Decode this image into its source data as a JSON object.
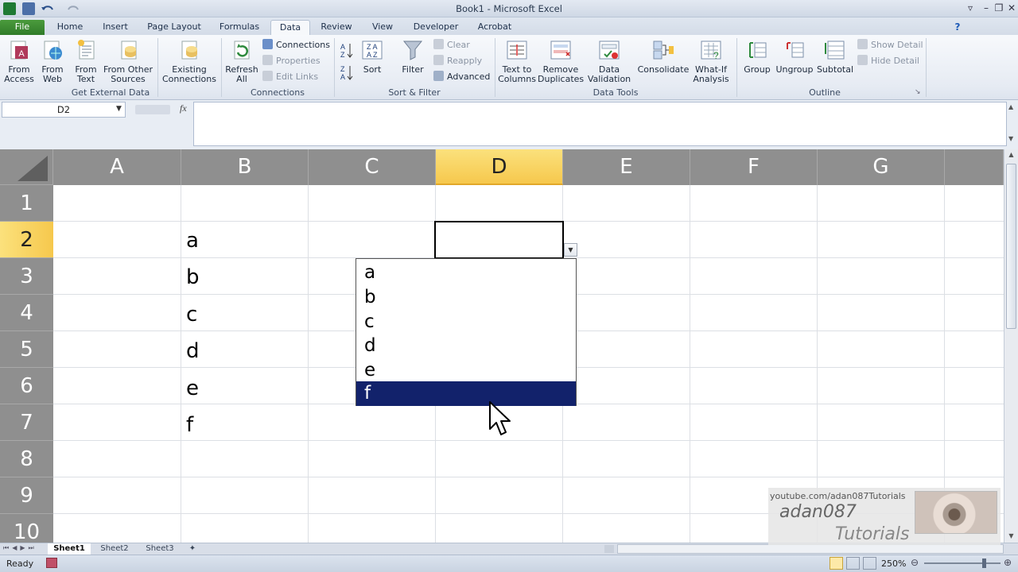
{
  "window": {
    "title": "Book1  -  Microsoft Excel"
  },
  "tabs": [
    {
      "label": "File"
    },
    {
      "label": "Home"
    },
    {
      "label": "Insert"
    },
    {
      "label": "Page Layout"
    },
    {
      "label": "Formulas"
    },
    {
      "label": "Data"
    },
    {
      "label": "Review"
    },
    {
      "label": "View"
    },
    {
      "label": "Developer"
    },
    {
      "label": "Acrobat"
    }
  ],
  "ribbon": {
    "external": {
      "label": "Get External Data",
      "from_access": [
        "From",
        "Access"
      ],
      "from_web": [
        "From",
        "Web"
      ],
      "from_text": [
        "From",
        "Text"
      ],
      "from_other": [
        "From Other",
        "Sources"
      ],
      "existing": [
        "Existing",
        "Connections"
      ]
    },
    "connections": {
      "label": "Connections",
      "refresh": [
        "Refresh",
        "All"
      ],
      "connections": "Connections",
      "properties": "Properties",
      "edit_links": "Edit Links"
    },
    "sortfilter": {
      "label": "Sort & Filter",
      "sort": "Sort",
      "filter": "Filter",
      "clear": "Clear",
      "reapply": "Reapply",
      "advanced": "Advanced"
    },
    "datatools": {
      "label": "Data Tools",
      "text_to_columns": [
        "Text to",
        "Columns"
      ],
      "remove_duplicates": [
        "Remove",
        "Duplicates"
      ],
      "data_validation": [
        "Data",
        "Validation"
      ],
      "consolidate": "Consolidate",
      "whatif": [
        "What-If",
        "Analysis"
      ]
    },
    "outline": {
      "label": "Outline",
      "group": "Group",
      "ungroup": "Ungroup",
      "subtotal": "Subtotal",
      "show_detail": "Show Detail",
      "hide_detail": "Hide Detail"
    }
  },
  "formula_bar": {
    "name_box": "D2",
    "fx": "fx",
    "formula": ""
  },
  "columns": [
    "A",
    "B",
    "C",
    "D",
    "E",
    "F",
    "G"
  ],
  "rows": [
    "1",
    "2",
    "3",
    "4",
    "5",
    "6",
    "7",
    "8",
    "9",
    "10"
  ],
  "selected_cell": "D2",
  "cells": {
    "B2": "a",
    "B3": "b",
    "B4": "c",
    "B5": "d",
    "B6": "e",
    "B7": "f"
  },
  "dropdown": {
    "items": [
      "a",
      "b",
      "c",
      "d",
      "e",
      "f"
    ],
    "highlighted": "f"
  },
  "sheets": [
    "Sheet1",
    "Sheet2",
    "Sheet3"
  ],
  "status": {
    "ready": "Ready",
    "zoom": "250%"
  },
  "watermark": {
    "url": "youtube.com/adan087Tutorials",
    "name": "adan087",
    "subtitle": "Tutorials"
  },
  "colors": {
    "file_tab": "#2f7a28",
    "selection_header": "#f6c84d",
    "dropdown_highlight": "#12226b",
    "header_gray": "#8f8f8f"
  }
}
